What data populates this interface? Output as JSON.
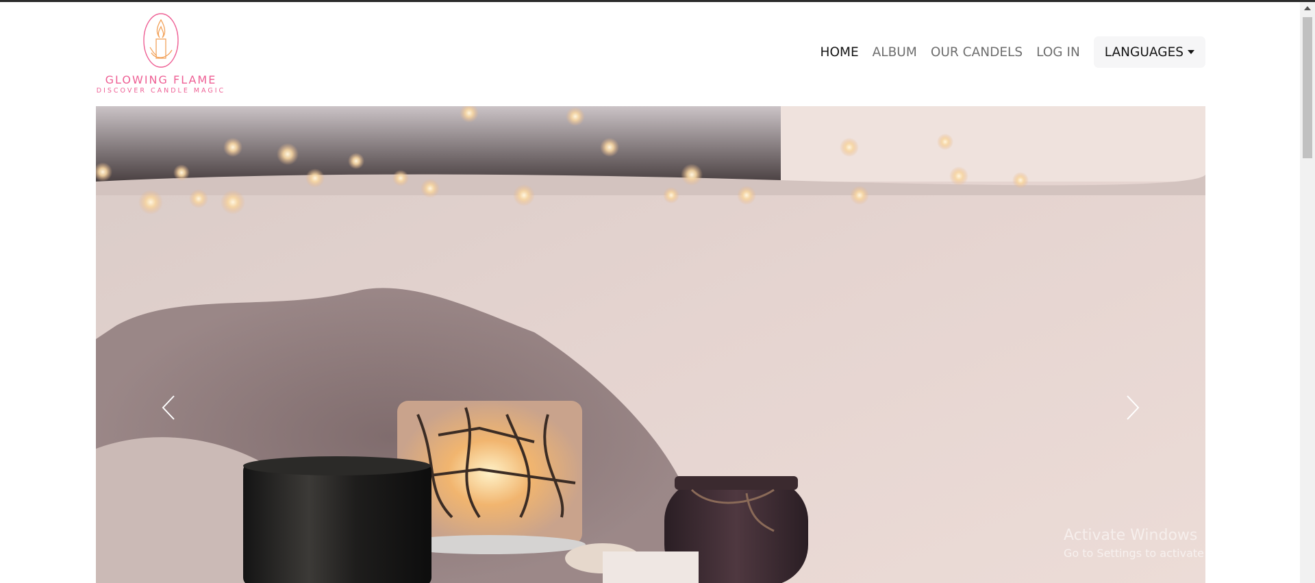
{
  "header": {
    "brand_name": "GLOWING FLAME",
    "brand_tagline": "DISCOVER CANDLE MAGIC",
    "logo_icon": "candle-flame-icon"
  },
  "nav": {
    "items": [
      {
        "label": "HOME",
        "active": true
      },
      {
        "label": "ALBUM",
        "active": false
      },
      {
        "label": "OUR CANDELS",
        "active": false
      },
      {
        "label": "LOG IN",
        "active": false
      }
    ],
    "languages_label": "LANGUAGES"
  },
  "carousel": {
    "image_subject": "candles-cozy-scene",
    "prev_icon": "chevron-left-icon",
    "next_icon": "chevron-right-icon"
  },
  "watermark": {
    "title": "Activate Windows",
    "subtitle": "Go to Settings to activate Windows."
  },
  "colors": {
    "brand_pink": "#ee5f94",
    "logo_orange": "#f2a25a",
    "nav_active": "#141414",
    "nav_inactive": "#6e6e6e"
  }
}
